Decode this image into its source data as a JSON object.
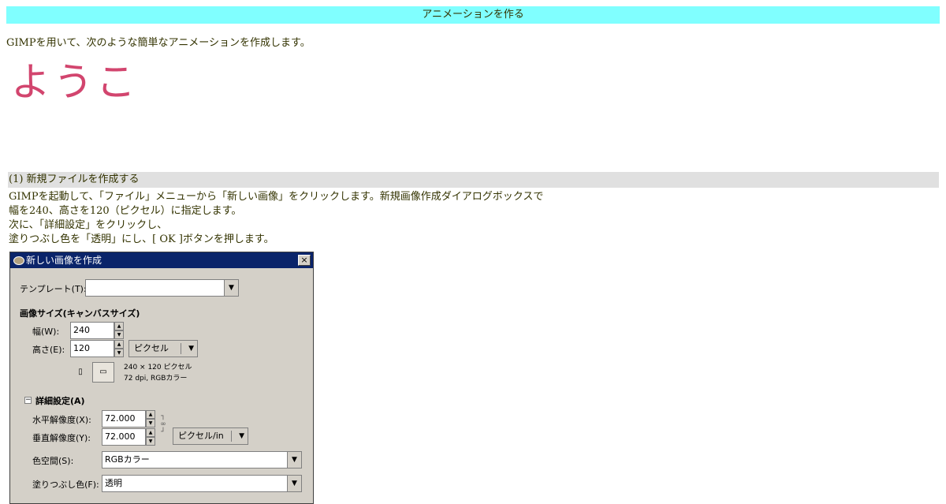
{
  "page": {
    "title": "アニメーションを作る",
    "intro": "GIMPを用いて、次のような簡単なアニメーションを作成します。",
    "animation_text": "ようこ",
    "animation_color": "#d2456e"
  },
  "section1": {
    "heading": "(1) 新規ファイルを作成する",
    "lines": [
      "GIMPを起動して、「ファイル」メニューから「新しい画像」をクリックします。新規画像作成ダイアログボックスで",
      "幅を240、高さを120（ピクセル）に指定します。",
      "次に、「詳細設定」をクリックし、",
      "塗りつぶし色を「透明」にし、[ OK ]ボタンを押します。"
    ]
  },
  "dialog": {
    "title": "新しい画像を作成",
    "close_label": "×",
    "template_label": "テンプレート(T):",
    "template_value": "",
    "image_size_heading": "画像サイズ(キャンバスサイズ)",
    "width_label": "幅(W):",
    "width_value": "240",
    "height_label": "高さ(E):",
    "height_value": "120",
    "size_unit": "ピクセル",
    "size_info_line1": "240 × 120 ピクセル",
    "size_info_line2": "72 dpi, RGBカラー",
    "advanced_label": "詳細設定(A)",
    "xres_label": "水平解像度(X):",
    "xres_value": "72.000",
    "yres_label": "垂直解像度(Y):",
    "yres_value": "72.000",
    "res_unit": "ピクセル/in",
    "colorspace_label": "色空間(S):",
    "colorspace_value": "RGBカラー",
    "fill_label": "塗りつぶし色(F):",
    "fill_value": "透明"
  },
  "colors": {
    "title_bar": "#80ffff",
    "section_bar": "#e0e0e0",
    "text": "#333300",
    "dialog_titlebar": "#0a246a"
  }
}
